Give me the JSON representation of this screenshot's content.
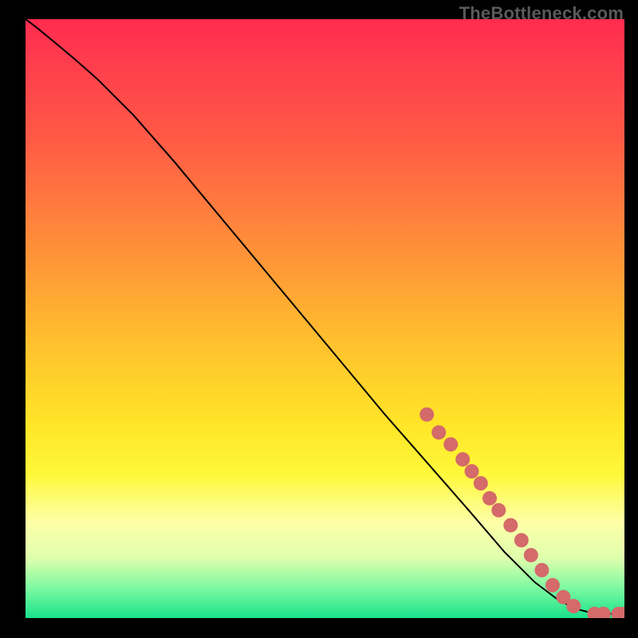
{
  "watermark": "TheBottleneck.com",
  "chart_data": {
    "type": "line",
    "title": "",
    "xlabel": "",
    "ylabel": "",
    "xlim": [
      0,
      100
    ],
    "ylim": [
      0,
      100
    ],
    "x": [
      0,
      2,
      5,
      8,
      12,
      18,
      25,
      30,
      40,
      50,
      60,
      67,
      74,
      80,
      85,
      89,
      92,
      94,
      96,
      98,
      100
    ],
    "values": [
      100,
      98.5,
      96,
      93.5,
      90,
      84,
      76,
      70,
      58,
      46,
      34,
      26,
      18,
      11,
      6,
      3,
      1.5,
      1,
      0.7,
      0.7,
      0.7
    ],
    "markers": [
      {
        "x": 67,
        "y": 34
      },
      {
        "x": 69,
        "y": 31
      },
      {
        "x": 71,
        "y": 29
      },
      {
        "x": 73,
        "y": 26.5
      },
      {
        "x": 74.5,
        "y": 24.5
      },
      {
        "x": 76,
        "y": 22.5
      },
      {
        "x": 77.5,
        "y": 20
      },
      {
        "x": 79,
        "y": 18
      },
      {
        "x": 81,
        "y": 15.5
      },
      {
        "x": 82.8,
        "y": 13
      },
      {
        "x": 84.4,
        "y": 10.5
      },
      {
        "x": 86.2,
        "y": 8
      },
      {
        "x": 88,
        "y": 5.5
      },
      {
        "x": 89.8,
        "y": 3.5
      },
      {
        "x": 91.5,
        "y": 2
      },
      {
        "x": 95,
        "y": 0.7
      },
      {
        "x": 96.5,
        "y": 0.7
      },
      {
        "x": 99,
        "y": 0.7
      },
      {
        "x": 100,
        "y": 0.7
      }
    ],
    "marker_color": "#d46a6a",
    "line_color": "#000000"
  }
}
